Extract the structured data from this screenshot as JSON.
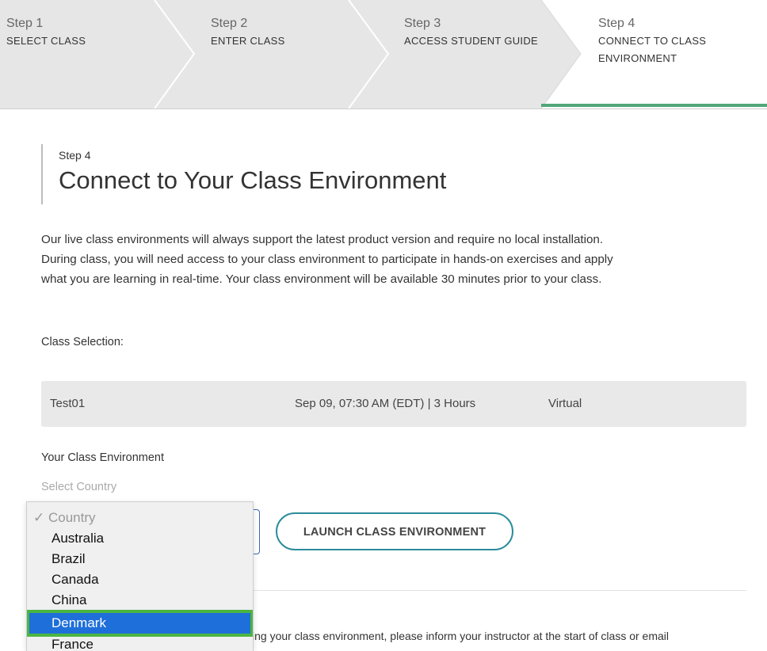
{
  "stepper": {
    "steps": [
      {
        "number": "Step 1",
        "title": "SELECT CLASS"
      },
      {
        "number": "Step 2",
        "title": "ENTER CLASS"
      },
      {
        "number": "Step 3",
        "title": "ACCESS STUDENT GUIDE"
      },
      {
        "number": "Step 4",
        "title_line1": "CONNECT TO CLASS",
        "title_line2": "ENVIRONMENT"
      }
    ],
    "active_index": 3,
    "active_color": "#52a77a"
  },
  "main": {
    "eyebrow": "Step 4",
    "title": "Connect to Your Class Environment",
    "intro_lines": [
      "Our live class environments will always support the latest product version and require no local installation.",
      "During class, you will need access to your class environment to participate in hands-on exercises and apply",
      "what you are learning in real-time. Your class environment will be available 30 minutes prior to your class."
    ],
    "class_selection_label": "Class Selection:",
    "class_row": {
      "name": "Test01",
      "schedule": "Sep 09, 07:30 AM (EDT) | 3 Hours",
      "mode": "Virtual"
    },
    "environment_label": "Your Class Environment",
    "select_country_label": "Select Country",
    "launch_button": "LAUNCH CLASS ENVIRONMENT",
    "bottom_text": "ing your class environment, please inform your instructor at the start of class or email"
  },
  "dropdown": {
    "placeholder": "✓ Country",
    "options": [
      "Australia",
      "Brazil",
      "Canada",
      "China",
      "Denmark",
      "France"
    ],
    "highlighted": "Denmark",
    "highlight_color": "#1e6fd9",
    "annotation_color": "#4bb543"
  }
}
